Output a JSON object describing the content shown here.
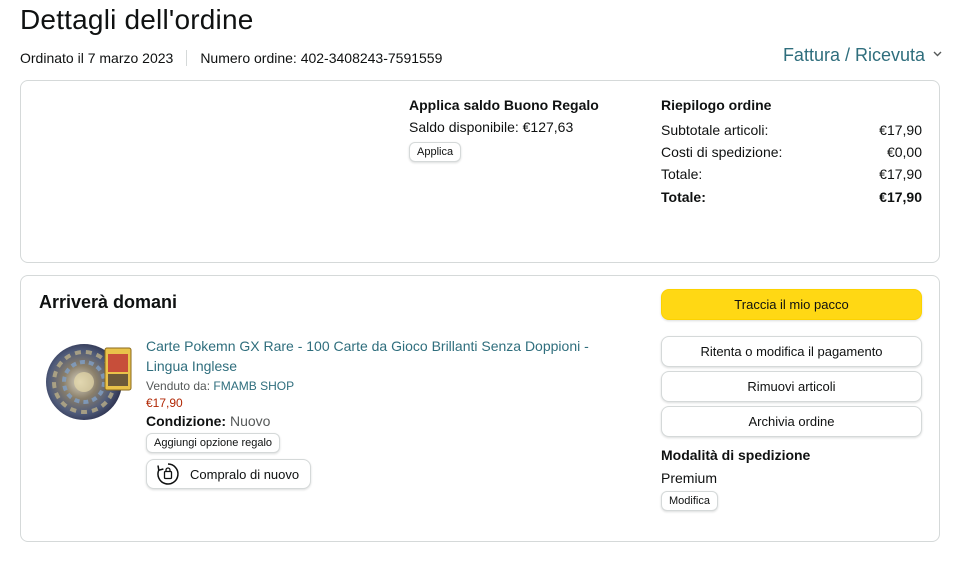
{
  "header": {
    "title": "Dettagli dell'ordine",
    "order_date": "Ordinato il 7 marzo 2023",
    "order_number": "Numero ordine: 402-3408243-7591559",
    "invoice_label": "Fattura / Ricevuta"
  },
  "gift_card": {
    "title": "Applica saldo Buono Regalo",
    "balance": "Saldo disponibile: €127,63",
    "apply_label": "Applica"
  },
  "order_summary": {
    "title": "Riepilogo ordine",
    "rows": [
      {
        "label": "Subtotale articoli:",
        "value": "€17,90"
      },
      {
        "label": "Costi di spedizione:",
        "value": "€0,00"
      },
      {
        "label": "Totale:",
        "value": "€17,90"
      },
      {
        "label": "Totale:",
        "value": "€17,90"
      }
    ]
  },
  "shipment": {
    "title": "Arriverà domani",
    "product": {
      "title": "Carte Pokemn GX Rare - 100 Carte da Gioco Brillanti Senza Doppioni - Lingua Inglese",
      "sold_by_label": "Venduto da:",
      "seller": "FMAMB SHOP",
      "price": "€17,90",
      "condition_label": "Condizione:",
      "condition_value": "Nuovo",
      "gift_option_label": "Aggiungi opzione regalo",
      "buy_again_label": "Compralo di nuovo"
    },
    "actions": {
      "track": "Traccia il mio pacco",
      "retry_payment": "Ritenta o modifica il pagamento",
      "remove_items": "Rimuovi articoli",
      "archive": "Archivia ordine"
    },
    "shipping_mode": {
      "title": "Modalità di spedizione",
      "value": "Premium",
      "edit_label": "Modifica"
    }
  },
  "icons": {
    "invoice_chevron": "chevron-down-icon",
    "buy_again": "buy-again-icon"
  },
  "colors": {
    "link": "#2f6e7d",
    "price": "#b12704",
    "primary_button": "#ffd814",
    "border": "#d5d9d9"
  }
}
